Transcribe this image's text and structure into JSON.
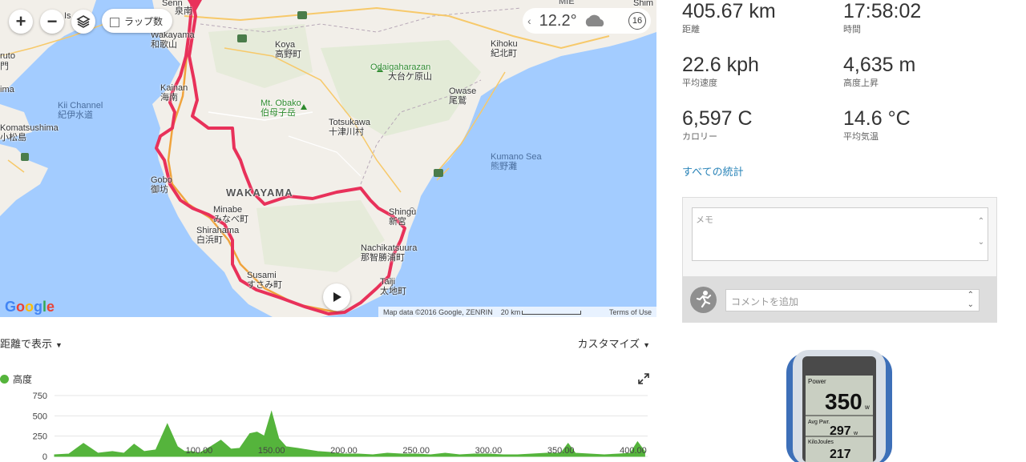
{
  "map": {
    "zoom_in": "+",
    "zoom_out": "−",
    "layers_icon": "layers-icon",
    "lap_label": "ラップ数",
    "weather": {
      "temp": "12.2°",
      "step": "16",
      "icon": "cloud-icon"
    },
    "google_logo": "Google",
    "attribution": {
      "data": "Map data ©2016 Google, ZENRIN",
      "scale": "20 km",
      "terms": "Terms of Use"
    },
    "labels": {
      "wakayama_en": "Wakayama",
      "wakayama_jp": "和歌山",
      "kainan_en": "Kainan",
      "kainan_jp": "海南",
      "koya_en": "Koya",
      "koya_jp": "高野町",
      "odaigahara_en": "Odaigaharazan",
      "odaigahara_jp": "大台ケ原山",
      "kihoku_en": "Kihoku",
      "kihoku_jp": "紀北町",
      "owase_en": "Owase",
      "owase_jp": "尾鷲",
      "kii_channel_en": "Kii Channel",
      "kii_channel_jp": "紀伊水道",
      "komatsushima_en": "Komatsushima",
      "komatsushima_jp": "小松島",
      "obako_en": "Mt. Obako",
      "obako_jp": "伯母子岳",
      "totsukawa_en": "Totsukawa",
      "totsukawa_jp": "十津川村",
      "kumano_sea_en": "Kumano Sea",
      "kumano_sea_jp": "熊野灘",
      "gobo_en": "Gobo",
      "gobo_jp": "御坊",
      "wakayama_pref": "WAKAYAMA",
      "minabe_en": "Minabe",
      "minabe_jp": "みなべ町",
      "shirahama_en": "Shirahama",
      "shirahama_jp": "白浜町",
      "shingu_en": "Shingu",
      "shingu_jp": "新宮",
      "nachi_en": "Nachikatsuura",
      "nachi_jp": "那智勝浦町",
      "susami_en": "Susami",
      "susami_jp": "すさみ町",
      "taiji_en": "Taiji",
      "taiji_jp": "太地町",
      "mie": "MIE",
      "izumi_jp": "泉南",
      "shim": "Shim",
      "aruto": "ruto",
      "mon": "門",
      "ima": "ima",
      "is": "Is",
      "senn": "Senn"
    }
  },
  "chart_header": {
    "view_by": "距離で表示",
    "customize": "カスタマイズ"
  },
  "chart_data": {
    "type": "area",
    "title": "",
    "series": [
      {
        "name": "高度",
        "color": "#55b43c"
      }
    ],
    "xlabel": "",
    "ylabel": "",
    "xlim": [
      0,
      410
    ],
    "ylim": [
      0,
      750
    ],
    "yticks": [
      "0",
      "250",
      "500",
      "750"
    ],
    "xticks": [
      "100.00",
      "150.00",
      "200.00",
      "250.00",
      "300.00",
      "350.00",
      "400.00"
    ],
    "x": [
      0,
      10,
      20,
      30,
      40,
      48,
      55,
      62,
      70,
      78,
      85,
      90,
      95,
      100,
      108,
      115,
      122,
      128,
      135,
      140,
      145,
      150,
      155,
      160,
      168,
      175,
      182,
      190,
      200,
      210,
      220,
      230,
      240,
      250,
      260,
      270,
      280,
      290,
      300,
      310,
      320,
      330,
      340,
      350,
      355,
      360,
      370,
      380,
      390,
      398,
      403,
      408
    ],
    "y": [
      20,
      30,
      160,
      40,
      60,
      40,
      150,
      60,
      80,
      400,
      120,
      60,
      60,
      40,
      120,
      200,
      90,
      100,
      280,
      300,
      250,
      550,
      220,
      120,
      100,
      80,
      60,
      50,
      30,
      30,
      20,
      40,
      30,
      30,
      20,
      40,
      20,
      30,
      30,
      20,
      20,
      30,
      40,
      40,
      160,
      40,
      30,
      20,
      30,
      40,
      180,
      60
    ]
  },
  "stats": [
    {
      "value": "405.67 km",
      "label": "距離"
    },
    {
      "value": "17:58:02",
      "label": "時間"
    },
    {
      "value": "22.6 kph",
      "label": "平均速度"
    },
    {
      "value": "4,635 m",
      "label": "高度上昇"
    },
    {
      "value": "6,597 C",
      "label": "カロリー"
    },
    {
      "value": "14.6 °C",
      "label": "平均気温"
    }
  ],
  "all_stats_link": "すべての統計",
  "memo_placeholder": "メモ",
  "comment_placeholder": "コメントを追加",
  "device": {
    "row1_label": "Power",
    "row1_value": "350",
    "row1_unit": "w",
    "row2_label": "Avg Pwr.",
    "row2_value": "297",
    "row2_unit": "w",
    "row3_label": "KiloJoules",
    "row3_value": "217"
  }
}
